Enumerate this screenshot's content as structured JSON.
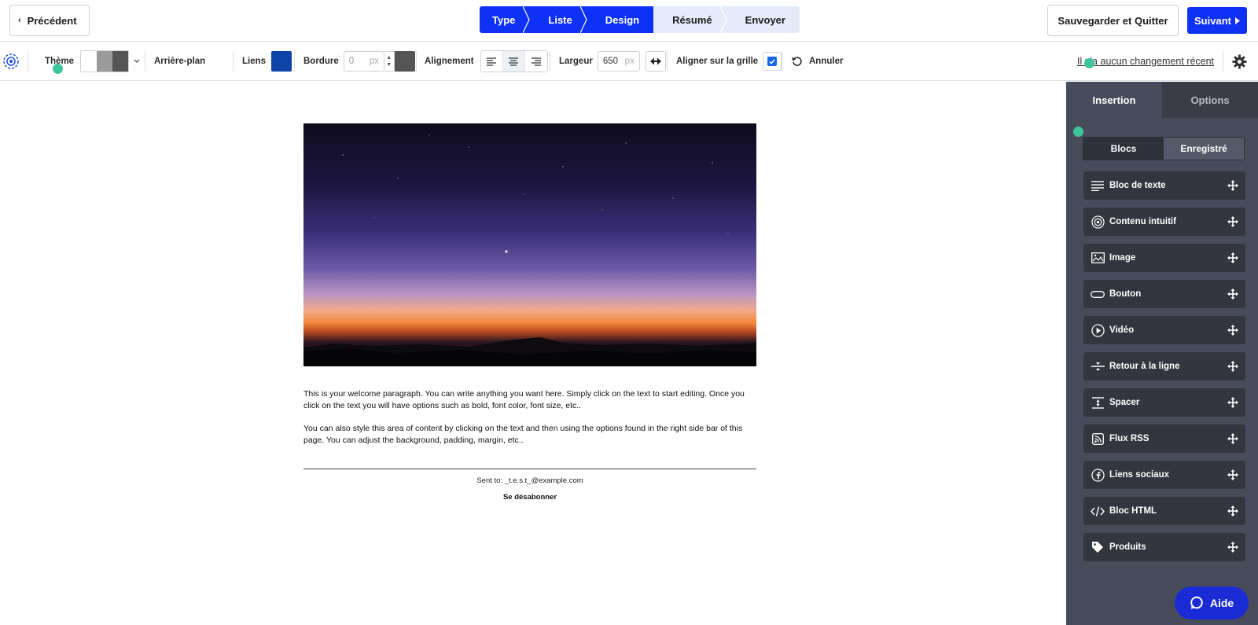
{
  "topbar": {
    "prev_label": "Précédent",
    "steps": [
      {
        "label": "Type",
        "state": "active"
      },
      {
        "label": "Liste",
        "state": "active"
      },
      {
        "label": "Design",
        "state": "active"
      },
      {
        "label": "Résumé",
        "state": "inactive"
      },
      {
        "label": "Envoyer",
        "state": "inactive"
      }
    ],
    "save_quit_label": "Sauvegarder et Quitter",
    "next_label": "Suivant"
  },
  "toolbar": {
    "theme_label": "Thème",
    "theme_colors": [
      "#ffffff",
      "#9a9a9a",
      "#555555"
    ],
    "background_label": "Arrière-plan",
    "links_label": "Liens",
    "links_color": "#0e44a8",
    "border_label": "Bordure",
    "border_value": "0",
    "border_unit": "px",
    "border_color": "#555555",
    "alignment_label": "Alignement",
    "alignment_selected": "center",
    "width_label": "Largeur",
    "width_value": "650",
    "width_unit": "px",
    "grid_label": "Aligner sur la grille",
    "grid_checked": true,
    "undo_label": "Annuler",
    "recent_label": "Il n'a aucun changement récent"
  },
  "email": {
    "paragraph1": "This is your welcome paragraph. You can write anything you want here. Simply click on the text to start editing. Once you click on the text you will have options such as bold, font color, font size, etc..",
    "paragraph2": "You can also style this area of content by clicking on the text and then using the options found in the right side bar of this page. You can adjust the background, padding, margin, etc..",
    "sent_to": "Sent to: _t.e.s.t_@example.com",
    "unsubscribe": "Se désabonner"
  },
  "panel": {
    "tabs": [
      {
        "label": "Insertion",
        "state": "active"
      },
      {
        "label": "Options",
        "state": "inactive"
      }
    ],
    "sub_tabs": [
      {
        "label": "Blocs",
        "state": "active"
      },
      {
        "label": "Enregistré",
        "state": "inactive"
      }
    ],
    "blocks": [
      {
        "label": "Bloc de texte",
        "icon": "text-lines-icon"
      },
      {
        "label": "Contenu intuitif",
        "icon": "target-icon"
      },
      {
        "label": "Image",
        "icon": "image-icon"
      },
      {
        "label": "Bouton",
        "icon": "button-icon"
      },
      {
        "label": "Vidéo",
        "icon": "play-icon"
      },
      {
        "label": "Retour à la ligne",
        "icon": "divider-icon"
      },
      {
        "label": "Spacer",
        "icon": "spacer-icon"
      },
      {
        "label": "Flux RSS",
        "icon": "rss-icon"
      },
      {
        "label": "Liens sociaux",
        "icon": "facebook-icon"
      },
      {
        "label": "Bloc HTML",
        "icon": "code-icon"
      },
      {
        "label": "Produits",
        "icon": "tag-icon"
      }
    ]
  },
  "help_label": "Aide",
  "colors": {
    "accent": "#0e32f5",
    "panel_bg": "#484c5a",
    "block_bg": "#33363f",
    "marker": "#3fc59b"
  }
}
